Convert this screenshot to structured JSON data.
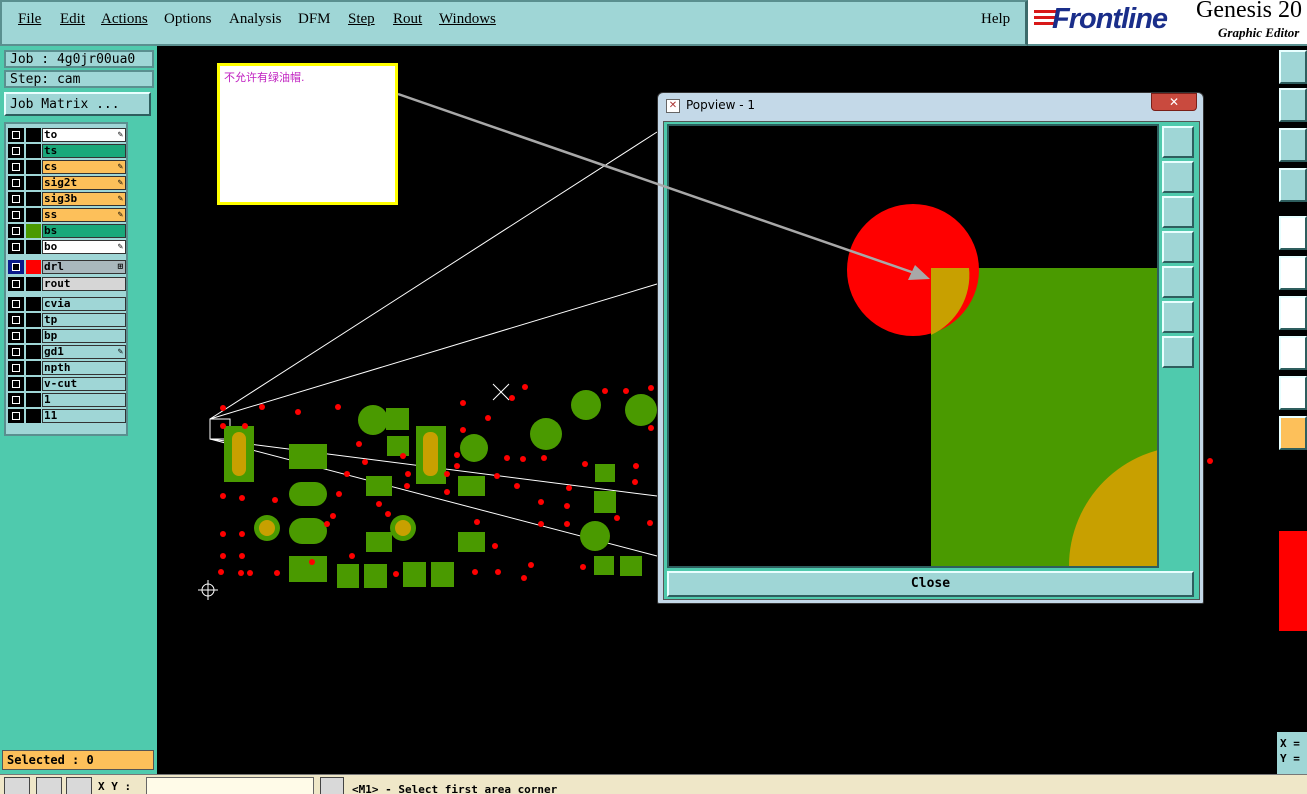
{
  "menu": {
    "items": [
      "File",
      "Edit",
      "Actions",
      "Options",
      "Analysis",
      "DFM",
      "Step",
      "Rout",
      "Windows"
    ],
    "help": "Help"
  },
  "brand": {
    "logo": "Frontline",
    "product": "Genesis 20",
    "subtitle": "Graphic Editor"
  },
  "job": {
    "job_label": "Job : 4g0jr00ua0",
    "step_label": "Step: cam",
    "matrix_button": "Job Matrix ..."
  },
  "layers": [
    {
      "name": "to",
      "color": "#ffffff",
      "swatch": "#000000",
      "mark": "✎"
    },
    {
      "name": "ts",
      "color": "#1aa87a",
      "swatch": "#000000",
      "mark": ""
    },
    {
      "name": "cs",
      "color": "#fdc05a",
      "swatch": "#000000",
      "mark": "✎"
    },
    {
      "name": "sig2t",
      "color": "#fdc05a",
      "swatch": "#000000",
      "mark": "✎"
    },
    {
      "name": "sig3b",
      "color": "#fdc05a",
      "swatch": "#000000",
      "mark": "✎"
    },
    {
      "name": "ss",
      "color": "#fdc05a",
      "swatch": "#000000",
      "mark": "✎"
    },
    {
      "name": "bs",
      "color": "#1aa87a",
      "swatch": "#4a9a00",
      "mark": ""
    },
    {
      "name": "bo",
      "color": "#ffffff",
      "swatch": "#000000",
      "mark": "✎"
    },
    {
      "name": "drl",
      "color": "#a9b8bd",
      "swatch": "#ff0000",
      "mark": "⊞",
      "active": true
    },
    {
      "name": "rout",
      "color": "#d6d6d6",
      "swatch": "#000000",
      "mark": ""
    },
    {
      "name": "cvia",
      "color": "#9fd6d6",
      "swatch": "#000000",
      "mark": ""
    },
    {
      "name": "tp",
      "color": "#9fd6d6",
      "swatch": "#000000",
      "mark": ""
    },
    {
      "name": "bp",
      "color": "#9fd6d6",
      "swatch": "#000000",
      "mark": ""
    },
    {
      "name": "gd1",
      "color": "#9fd6d6",
      "swatch": "#000000",
      "mark": "✎"
    },
    {
      "name": "npth",
      "color": "#9fd6d6",
      "swatch": "#000000",
      "mark": ""
    },
    {
      "name": "v-cut",
      "color": "#9fd6d6",
      "swatch": "#000000",
      "mark": ""
    },
    {
      "name": "1",
      "color": "#9fd6d6",
      "swatch": "#000000",
      "mark": ""
    },
    {
      "name": "11",
      "color": "#9fd6d6",
      "swatch": "#000000",
      "mark": ""
    }
  ],
  "selected_label": "Selected : 0",
  "note": {
    "text": "不允许有绿油帽."
  },
  "popview": {
    "title": "Popview - 1",
    "close_x": "✕",
    "close_button": "Close"
  },
  "status": {
    "xy_label": "X Y :",
    "xy_value": "",
    "message": "<M1> - Select first area corner"
  },
  "coords": {
    "x_label": "X =",
    "y_label": "Y ="
  },
  "colors": {
    "panel": "#4fcaad",
    "widget": "#9fd6d6",
    "copper": "#4a9a00",
    "drill": "#ff0000",
    "overlap": "#c8a000",
    "note_border": "#ffff00",
    "note_text": "#c020c0"
  }
}
